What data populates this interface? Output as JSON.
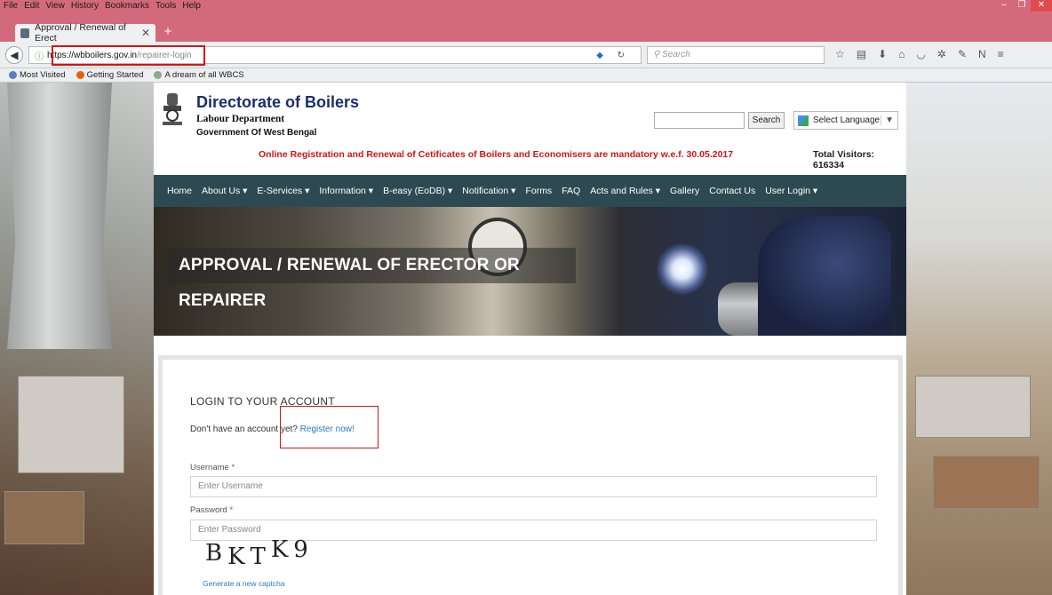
{
  "browser": {
    "menu": [
      "File",
      "Edit",
      "View",
      "History",
      "Bookmarks",
      "Tools",
      "Help"
    ],
    "tab_title": "Approval / Renewal of Erect",
    "url_host": "https://wbboilers.gov.in",
    "url_path": "/repairer-login",
    "search_placeholder": "Search",
    "bookmarks": [
      "Most Visited",
      "Getting Started",
      "A dream of all WBCS"
    ]
  },
  "site": {
    "title": "Directorate of Boilers",
    "subtitle1": "Labour Department",
    "subtitle2": "Government Of West Bengal",
    "search_button": "Search",
    "language_select": "Select Language",
    "notice": "Online Registration and Renewal of Cetificates of Boilers and Economisers are mandatory w.e.f. 30.05.2017",
    "visitors": "Total Visitors: 616334",
    "nav": [
      "Home",
      "About Us ▾",
      "E-Services ▾",
      "Information ▾",
      "B-easy (EoDB) ▾",
      "Notification ▾",
      "Forms",
      "FAQ",
      "Acts and Rules ▾",
      "Gallery",
      "Contact Us",
      "User Login ▾"
    ],
    "banner_title": "APPROVAL / RENEWAL OF ERECTOR OR REPAIRER"
  },
  "login": {
    "heading": "LOGIN TO YOUR ACCOUNT",
    "no_account": "Don't have an account yet?",
    "register": "Register now!",
    "username_label": "Username",
    "username_placeholder": "Enter Username",
    "password_label": "Password",
    "password_placeholder": "Enter Password",
    "required_mark": "*",
    "captcha": [
      "B",
      "KT",
      "K9"
    ],
    "new_captcha": "Generate a new captcha"
  },
  "colors": {
    "browser_chrome": "#d36a7c",
    "nav_bar": "#2d4a52",
    "notice_red": "#d01515",
    "link_blue": "#2a7ac0",
    "highlight_red": "#dd1111"
  }
}
